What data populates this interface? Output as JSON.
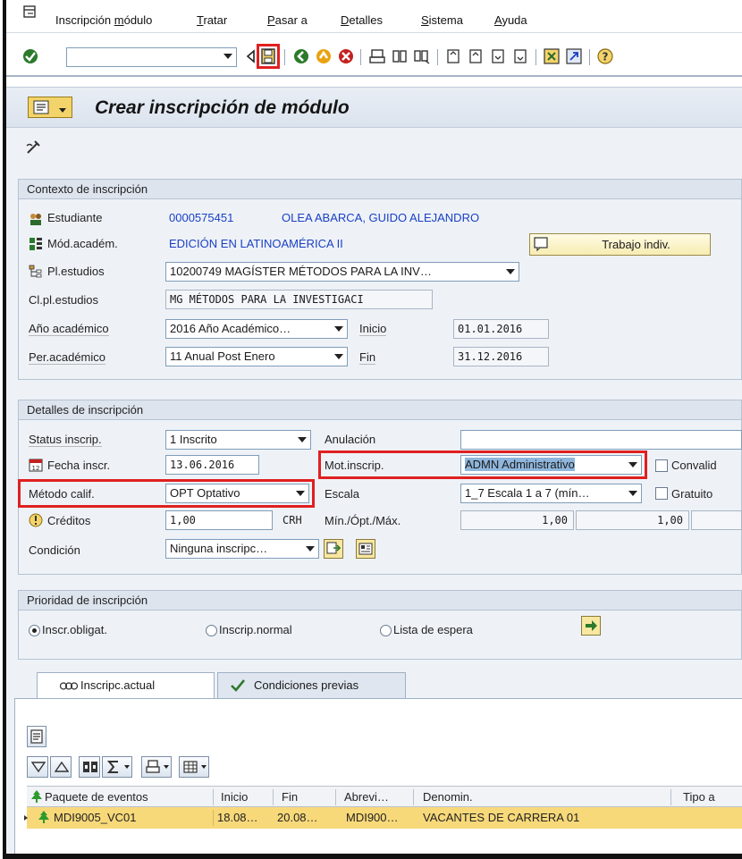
{
  "menu": {
    "items": [
      {
        "pre": "Inscripción ",
        "u": "m",
        "post": "ódulo"
      },
      {
        "pre": "",
        "u": "T",
        "post": "ratar"
      },
      {
        "pre": "",
        "u": "P",
        "post": "asar a"
      },
      {
        "pre": "",
        "u": "D",
        "post": "etalles"
      },
      {
        "pre": "",
        "u": "S",
        "post": "istema"
      },
      {
        "pre": "",
        "u": "A",
        "post": "yuda"
      }
    ]
  },
  "toolbar": {
    "command_value": "",
    "icons": [
      "check-icon",
      "back-arrow-icon",
      "save-icon",
      "back-icon",
      "exit-icon",
      "cancel-icon",
      "print-icon",
      "find-icon",
      "find-next-icon",
      "first-page-icon",
      "previous-page-icon",
      "next-page-icon",
      "last-page-icon",
      "create-session-icon",
      "shortcut-icon",
      "help-icon"
    ]
  },
  "title": "Crear inscripción de módulo",
  "context": {
    "header": "Contexto de inscripción",
    "student_label": "Estudiante",
    "student_id": "0000575451",
    "student_name": "OLEA ABARCA, GUIDO ALEJANDRO",
    "module_label": "Mód.académ.",
    "module_value": "EDICIÓN EN LATINOAMÉRICA II",
    "work_button": "Trabajo indiv.",
    "plan_label": "Pl.estudios",
    "plan_value": "10200749 MAGÍSTER MÉTODOS PARA LA INV…",
    "class_label": "Cl.pl.estudios",
    "class_value": "MG MÉTODOS PARA LA INVESTIGACI",
    "year_label": "Año académico",
    "year_value": "2016 Año Académico…",
    "start_label": "Inicio",
    "start_value": "01.01.2016",
    "period_label": "Per.académico",
    "period_value": "11 Anual Post Enero",
    "end_label": "Fin",
    "end_value": "31.12.2016"
  },
  "details": {
    "header": "Detalles de inscripción",
    "status_label": "Status inscrip.",
    "status_value": "1 Inscrito",
    "cancel_label": "Anulación",
    "cancel_value": "",
    "date_label": "Fecha inscr.",
    "date_value": "13.06.2016",
    "reason_label": "Mot.inscrip.",
    "reason_value": "ADMN Administrativo",
    "convalid_label": "Convalid",
    "method_label": "Método calif.",
    "method_value": "OPT Optativo",
    "scale_label": "Escala",
    "scale_value": "1_7 Escala 1 a 7 (mín…",
    "free_label": "Gratuito",
    "credits_label": "Créditos",
    "credits_value": "1,00",
    "credits_unit": "CRH",
    "minmax_label": "Mín./Ópt./Máx.",
    "min_value": "1,00",
    "opt_value": "1,00",
    "condition_label": "Condición",
    "condition_value": "Ninguna inscripc…"
  },
  "priority": {
    "header": "Prioridad de inscripción",
    "options": [
      "Inscr.obligat.",
      "Inscrip.normal",
      "Lista de espera"
    ],
    "selected": 0
  },
  "tabs": [
    {
      "label": "Inscripc.actual"
    },
    {
      "label": "Condiciones previas"
    }
  ],
  "grid": {
    "columns": [
      "Paquete de eventos",
      "Inicio",
      "Fin",
      "Abrevi…",
      "Denomin.",
      "Tipo a"
    ],
    "rows": [
      {
        "package": "MDI9005_VC01",
        "start": "18.08…",
        "end": "20.08…",
        "abbr": "MDI900…",
        "name": "VACANTES DE CARRERA 01"
      }
    ]
  },
  "colors": {
    "highlight_box": "#e02020",
    "selected_row": "#f8d97a",
    "link_blue": "#1a3fc4"
  }
}
